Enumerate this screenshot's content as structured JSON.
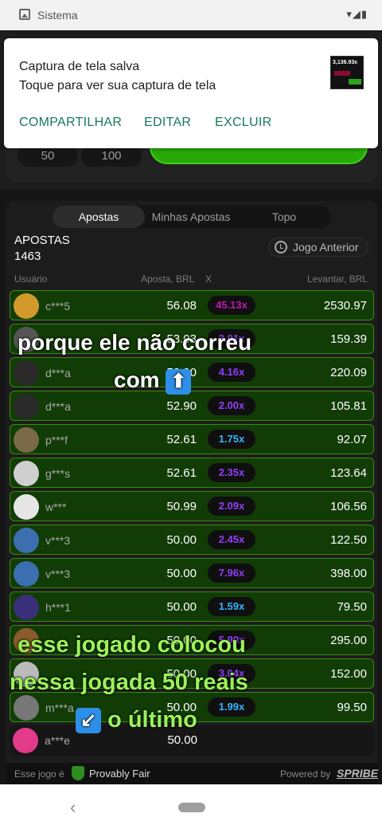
{
  "status": {
    "app_name": "Sistema",
    "icons": "▾◢▮"
  },
  "notification": {
    "title": "Captura de tela salva",
    "subtitle": "Toque para ver sua captura de tela",
    "thumb_value": "3,136.93x",
    "actions": [
      "COMPARTILHAR",
      "EDITAR",
      "EXCLUIR"
    ]
  },
  "bet_chips": [
    "50",
    "100"
  ],
  "tabs": [
    "Apostas",
    "Minhas Apostas",
    "Topo"
  ],
  "bets": {
    "title": "APOSTAS",
    "count": "1463",
    "prev_button": "Jogo Anterior",
    "headers": [
      "Usuário",
      "Aposta, BRL",
      "X",
      "Levantar, BRL"
    ]
  },
  "rows": [
    {
      "user": "c***5",
      "bet": "56.08",
      "mult": "45.13x",
      "mult_color": "#c017b4",
      "cashout": "2530.97",
      "win": true,
      "av": "#d29a2b"
    },
    {
      "user": "",
      "bet": "53.03",
      "mult": "3.01x",
      "mult_color": "#913ef8",
      "cashout": "159.39",
      "win": true,
      "av": "#555"
    },
    {
      "user": "d***a",
      "bet": "52.90",
      "mult": "4.16x",
      "mult_color": "#913ef8",
      "cashout": "220.09",
      "win": true,
      "av": "#2a2a2a"
    },
    {
      "user": "d***a",
      "bet": "52.90",
      "mult": "2.00x",
      "mult_color": "#913ef8",
      "cashout": "105.81",
      "win": true,
      "av": "#2a2a2a"
    },
    {
      "user": "p***f",
      "bet": "52.61",
      "mult": "1.75x",
      "mult_color": "#34b4ff",
      "cashout": "92.07",
      "win": true,
      "av": "#7a6a4a"
    },
    {
      "user": "g***s",
      "bet": "52.61",
      "mult": "2.35x",
      "mult_color": "#913ef8",
      "cashout": "123.64",
      "win": true,
      "av": "#cfcfcf"
    },
    {
      "user": "w***",
      "bet": "50.99",
      "mult": "2.09x",
      "mult_color": "#913ef8",
      "cashout": "106.56",
      "win": true,
      "av": "#e6e6e6"
    },
    {
      "user": "v***3",
      "bet": "50.00",
      "mult": "2.45x",
      "mult_color": "#913ef8",
      "cashout": "122.50",
      "win": true,
      "av": "#3b6fb0"
    },
    {
      "user": "v***3",
      "bet": "50.00",
      "mult": "7.96x",
      "mult_color": "#913ef8",
      "cashout": "398.00",
      "win": true,
      "av": "#3b6fb0"
    },
    {
      "user": "h***1",
      "bet": "50.00",
      "mult": "1.59x",
      "mult_color": "#34b4ff",
      "cashout": "79.50",
      "win": true,
      "av": "#3a2f7a"
    },
    {
      "user": "",
      "bet": "50.00",
      "mult": "5.90x",
      "mult_color": "#913ef8",
      "cashout": "295.00",
      "win": true,
      "av": "#8a5b2b"
    },
    {
      "user": "",
      "bet": "50.00",
      "mult": "3.04x",
      "mult_color": "#913ef8",
      "cashout": "152.00",
      "win": true,
      "av": "#bbbbbb"
    },
    {
      "user": "m***a",
      "bet": "50.00",
      "mult": "1.99x",
      "mult_color": "#34b4ff",
      "cashout": "99.50",
      "win": true,
      "av": "#777"
    },
    {
      "user": "a***e",
      "bet": "50.00",
      "mult": "",
      "mult_color": "#000",
      "cashout": "",
      "win": false,
      "av": "#e33b8b"
    }
  ],
  "footer": {
    "left": "Esse jogo é",
    "fair": "Provably Fair",
    "powered": "Powered by",
    "brand": "SPRIBE"
  },
  "captions": {
    "line1": "porque ele não correu",
    "line2": "com",
    "line3": "esse jogado colocou",
    "line4": "nessa jogada 50 reais",
    "line5": "o último",
    "arrow_up": "⬆️",
    "arrow_dl": "↙️"
  }
}
